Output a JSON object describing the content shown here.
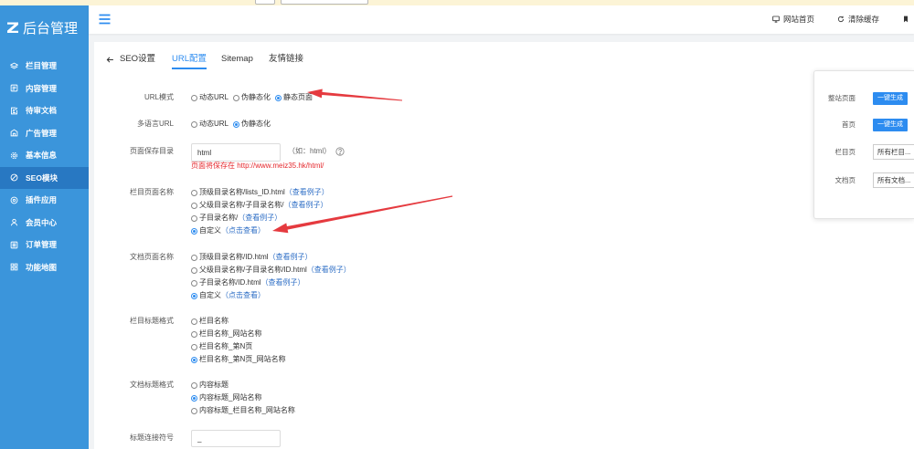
{
  "colors": {
    "notice_strip": "#fcf4d6",
    "sidebar_bg": "#3b95db",
    "sidebar_active_bg": "#2878c2",
    "accent": "#2d8cf0",
    "link": "#2f6fc6",
    "warning_text": "#e5282d",
    "annotation_arrow": "#e53a3f"
  },
  "sidebar": {
    "logo_icon": "logo-z-icon",
    "logo_text": "后台管理",
    "items": [
      {
        "label": "栏目管理",
        "icon": "layers-icon",
        "active": false
      },
      {
        "label": "内容管理",
        "icon": "document-list-icon",
        "active": false
      },
      {
        "label": "待审文档",
        "icon": "document-edit-icon",
        "active": false
      },
      {
        "label": "广告管理",
        "icon": "shop-icon",
        "active": false
      },
      {
        "label": "基本信息",
        "icon": "gear-icon",
        "active": false
      },
      {
        "label": "SEO模块",
        "icon": "compass-icon",
        "active": true
      },
      {
        "label": "插件应用",
        "icon": "plugin-icon",
        "active": false
      },
      {
        "label": "会员中心",
        "icon": "user-icon",
        "active": false
      },
      {
        "label": "订单管理",
        "icon": "order-list-icon",
        "active": false
      },
      {
        "label": "功能地图",
        "icon": "grid-icon",
        "active": false
      }
    ]
  },
  "header": {
    "menu_icon": "hamburger-icon",
    "links": [
      {
        "label": "网站首页",
        "icon": "monitor-icon"
      },
      {
        "label": "清除缓存",
        "icon": "refresh-icon"
      },
      {
        "icon": "bookmark-icon"
      }
    ]
  },
  "tabs": {
    "back_icon": "arrow-left-icon",
    "back_label": "SEO设置",
    "items": [
      {
        "label": "URL配置",
        "active": true
      },
      {
        "label": "Sitemap",
        "active": false
      },
      {
        "label": "友情链接",
        "active": false
      }
    ]
  },
  "form": {
    "url_mode": {
      "label": "URL模式",
      "options": [
        "动态URL",
        "伪静态化",
        "静态页面"
      ],
      "selected": 2
    },
    "lang_url": {
      "label": "多语言URL",
      "options": [
        "动态URL",
        "伪静态化"
      ],
      "selected": 1
    },
    "save_dir": {
      "label": "页面保存目录",
      "value": "html",
      "hint": "（如：html）",
      "help_icon": "question-circle-icon",
      "note": "页面将保存在 http://www.meiz35.hk/html/"
    },
    "column_page_name": {
      "label": "栏目页面名称",
      "options": [
        {
          "text": "顶级目录名称/lists_ID.html",
          "link": "（查看例子）"
        },
        {
          "text": "父级目录名称/子目录名称/",
          "link": "（查看例子）"
        },
        {
          "text": "子目录名称/",
          "link": "（查看例子）"
        },
        {
          "text": "自定义",
          "link": "（点击查看）"
        }
      ],
      "selected": 3
    },
    "doc_page_name": {
      "label": "文档页面名称",
      "options": [
        {
          "text": "顶级目录名称/ID.html",
          "link": "（查看例子）"
        },
        {
          "text": "父级目录名称/子目录名称/ID.html",
          "link": "（查看例子）"
        },
        {
          "text": "子目录名称/ID.html",
          "link": "（查看例子）"
        },
        {
          "text": "自定义",
          "link": "（点击查看）"
        }
      ],
      "selected": 3
    },
    "column_title_format": {
      "label": "栏目标题格式",
      "options": [
        "栏目名称",
        "栏目名称_网站名称",
        "栏目名称_第N页",
        "栏目名称_第N页_网站名称"
      ],
      "selected": 3
    },
    "doc_title_format": {
      "label": "文档标题格式",
      "options": [
        "内容标题",
        "内容标题_网站名称",
        "内容标题_栏目名称_网站名称"
      ],
      "selected": 1
    },
    "title_separator": {
      "label": "标题连接符号",
      "value": "_"
    }
  },
  "generate_panel": {
    "rows": [
      {
        "label": "整站页面",
        "button": "一键生成"
      },
      {
        "label": "首页",
        "button": "一键生成"
      },
      {
        "label": "栏目页",
        "select": "所有栏目..."
      },
      {
        "label": "文档页",
        "select": "所有文档..."
      }
    ]
  }
}
